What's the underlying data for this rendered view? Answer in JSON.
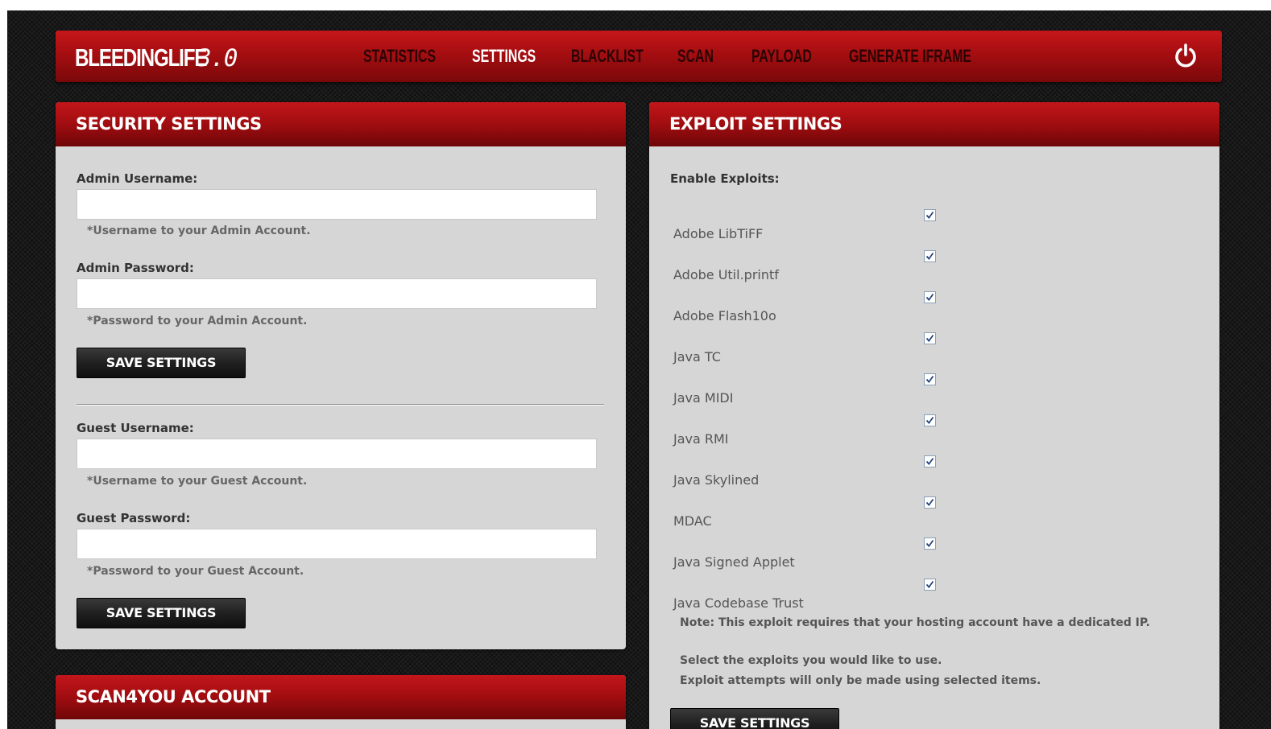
{
  "app": {
    "logo_text": "BLEEDINGLIFE",
    "logo_version": "3.0"
  },
  "nav": {
    "items": [
      {
        "label": "STATISTICS"
      },
      {
        "label": "SETTINGS"
      },
      {
        "label": "BLACKLIST"
      },
      {
        "label": "SCAN"
      },
      {
        "label": "PAYLOAD"
      },
      {
        "label": "GENERATE IFRAME"
      }
    ],
    "active": "SETTINGS",
    "power_icon": "power-icon"
  },
  "security": {
    "title": "SECURITY SETTINGS",
    "admin_username_label": "Admin Username:",
    "admin_username_value": "",
    "admin_username_hint": "*Username to your Admin Account.",
    "admin_password_label": "Admin Password:",
    "admin_password_value": "",
    "admin_password_hint": "*Password to your Admin Account.",
    "save_label_1": "SAVE SETTINGS",
    "guest_username_label": "Guest Username:",
    "guest_username_value": "",
    "guest_username_hint": "*Username to your Guest Account.",
    "guest_password_label": "Guest Password:",
    "guest_password_value": "",
    "guest_password_hint": "*Password to your Guest Account.",
    "save_label_2": "SAVE SETTINGS"
  },
  "scan4you": {
    "title": "SCAN4YOU ACCOUNT"
  },
  "exploits": {
    "title": "EXPLOIT SETTINGS",
    "enable_label": "Enable Exploits:",
    "items": [
      {
        "name": "Adobe LibTiFF",
        "checked": true
      },
      {
        "name": "Adobe Util.printf",
        "checked": true
      },
      {
        "name": "Adobe Flash10o",
        "checked": true
      },
      {
        "name": "Java TC",
        "checked": true
      },
      {
        "name": "Java MIDI",
        "checked": true
      },
      {
        "name": "Java RMI",
        "checked": true
      },
      {
        "name": "Java Skylined",
        "checked": true
      },
      {
        "name": "MDAC",
        "checked": true
      },
      {
        "name": "Java Signed Applet",
        "checked": true
      },
      {
        "name": "Java Codebase Trust",
        "checked": true
      }
    ],
    "note": "Note: This exploit requires that your hosting account have a dedicated IP.",
    "info_line_1": "Select the exploits you would like to use.",
    "info_line_2": "Exploit attempts will only be made using selected items.",
    "save_label": "SAVE SETTINGS"
  },
  "colors": {
    "header_red": "#a50e11",
    "panel_bg": "#d6d6d6",
    "page_bg": "#181818",
    "button_bg": "#1e1e1e"
  }
}
